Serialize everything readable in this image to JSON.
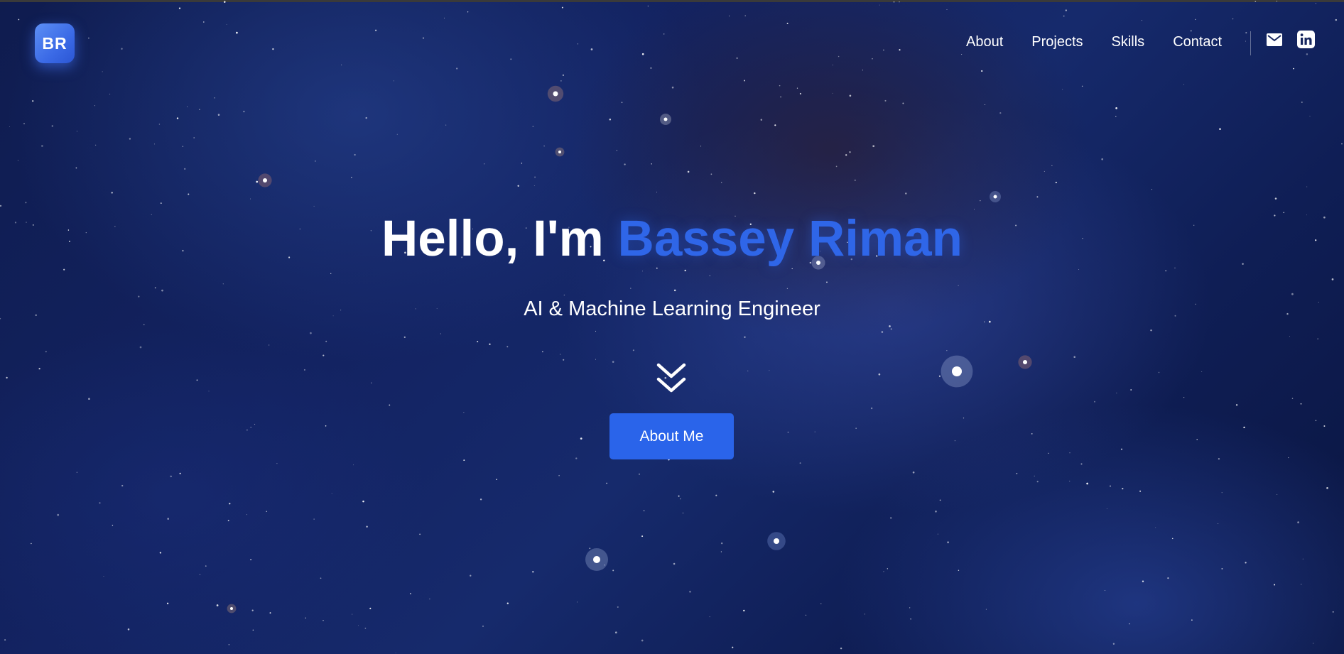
{
  "brand": {
    "logo_text": "BR",
    "accent_color": "#2f66e8"
  },
  "nav": {
    "items": [
      "About",
      "Projects",
      "Skills",
      "Contact"
    ],
    "icons": [
      "mail-icon",
      "linkedin-icon"
    ]
  },
  "hero": {
    "greeting": "Hello, I'm",
    "name": "Bassey Riman",
    "subtitle": "AI & Machine Learning Engineer",
    "scroll_icon": "double-chevron-down-icon",
    "button_label": "About Me"
  },
  "colors": {
    "background": "#132362",
    "button": "#2a64ea",
    "text": "#ffffff"
  }
}
